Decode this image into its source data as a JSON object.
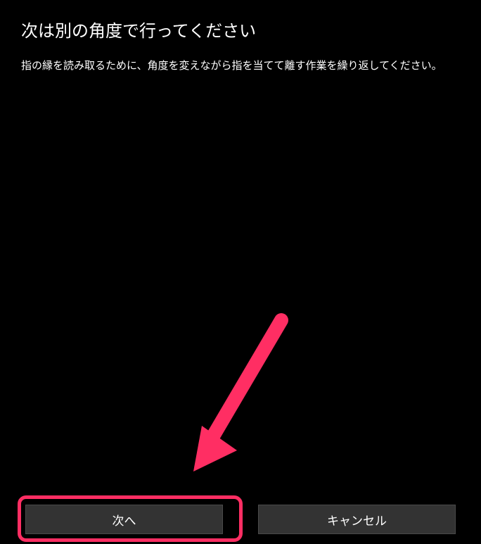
{
  "dialog": {
    "title": "次は別の角度で行ってください",
    "description": "指の縁を読み取るために、角度を変えながら指を当てて離す作業を繰り返してください。"
  },
  "buttons": {
    "next": "次へ",
    "cancel": "キャンセル"
  },
  "annotation": {
    "arrow_color": "#ff2e63",
    "highlight_color": "#ff2e63"
  }
}
